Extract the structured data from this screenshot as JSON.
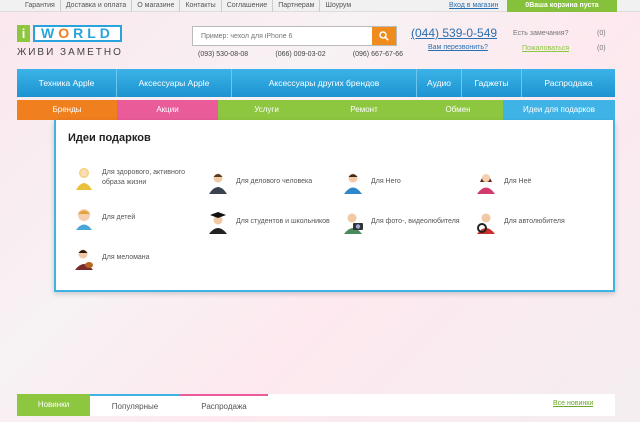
{
  "topmenu": [
    "Гарантия",
    "Доставка и оплата",
    "О магазине",
    "Контакты",
    "Соглашение",
    "Партнерам",
    "Шоурум"
  ],
  "login_label": "Вход в магазин",
  "cart_label": "0Ваша корзина пуста",
  "logo": {
    "tagline": "ЖИВИ ЗАМЕТНО"
  },
  "search": {
    "placeholder": "Пример: чехол для iPhone 6",
    "value": ""
  },
  "phones": [
    "(093) 530-08-08",
    "(066) 009-03-02",
    "(096) 667-67-66"
  ],
  "main_phone": "(044) 539-0-549",
  "callback_label": "Вам перезвонить?",
  "remarks": {
    "label": "Есть замечания?",
    "count": "(0)"
  },
  "compare": {
    "label": "Пожаловаться",
    "count": "(0)"
  },
  "mainnav": [
    "Техника Apple",
    "Аксессуары Apple",
    "Аксессуары других брендов",
    "Аудио",
    "Гаджеты",
    "Распродажа"
  ],
  "subnav": [
    {
      "label": "Бренды",
      "color": "#f07f1e"
    },
    {
      "label": "Акции",
      "color": "#ea5b9a"
    },
    {
      "label": "Услуги",
      "color": "#8dc63f"
    },
    {
      "label": "Ремонт",
      "color": "#8dc63f"
    },
    {
      "label": "Обмен",
      "color": "#8dc63f"
    },
    {
      "label": "Идеи для подарков",
      "color": "#3fb3e5"
    }
  ],
  "panel": {
    "title": "Идеи подарков",
    "items": [
      {
        "label": "Для здорового, активного образа жизни",
        "icon": "sporty-person-icon"
      },
      {
        "label": "Для делового человека",
        "icon": "business-person-icon"
      },
      {
        "label": "Для Него",
        "icon": "man-icon"
      },
      {
        "label": "Для Неё",
        "icon": "woman-icon"
      },
      {
        "label": "Для детей",
        "icon": "child-icon"
      },
      {
        "label": "Для студентов и школьников",
        "icon": "student-icon"
      },
      {
        "label": "Для фото-, видеолюбителя",
        "icon": "photographer-icon"
      },
      {
        "label": "Для автолюбителя",
        "icon": "driver-icon"
      },
      {
        "label": "Для меломана",
        "icon": "music-lover-icon"
      }
    ]
  },
  "bottom_tabs": [
    "Новинки",
    "Популярные",
    "Распродажа"
  ],
  "all_new_label": "Все новинки",
  "colors": {
    "blue": "#1d93d0",
    "green": "#8dc63f",
    "orange": "#f07f1e",
    "pink": "#ea5b9a"
  }
}
